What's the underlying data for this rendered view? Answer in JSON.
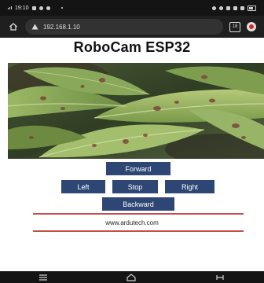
{
  "status_bar": {
    "time": "19:10"
  },
  "browser": {
    "url": "192.168.1.10",
    "tab_count": "18",
    "icons": {
      "home": "home-icon",
      "security": "warning-triangle-icon",
      "tabs": "tabs-icon",
      "menu": "browser-menu-icon"
    }
  },
  "page": {
    "title": "RoboCam ESP32",
    "buttons": {
      "forward": "Forward",
      "left": "Left",
      "stop": "Stop",
      "right": "Right",
      "backward": "Backward"
    },
    "footer_text": "www.ardutech.com"
  },
  "colors": {
    "button_bg": "#2d4673",
    "rule": "#c0504d",
    "chrome_bg": "#1f1f1f"
  }
}
